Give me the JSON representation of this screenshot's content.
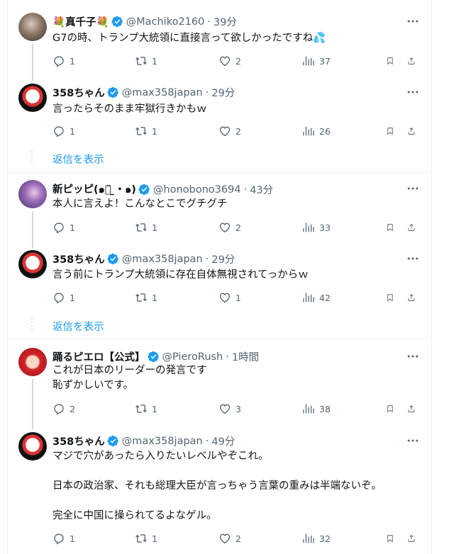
{
  "threads": [
    {
      "parent": {
        "name": "💐真千子💐",
        "handle": "@Machiko2160",
        "dot": "·",
        "time": "39分",
        "text": [
          "G7の時、トランプ大統領に直接言って欲しかったですね💦"
        ],
        "replies": "1",
        "retweets": "1",
        "likes": "2",
        "views": "37"
      },
      "reply": {
        "name": "358ちゃん",
        "handle": "@max358japan",
        "dot": "·",
        "time": "29分",
        "text": [
          "言ったらそのまま牢獄行きかもｗ"
        ],
        "replies": "1",
        "retweets": "1",
        "likes": "2",
        "views": "26"
      },
      "show_replies": "返信を表示"
    },
    {
      "parent": {
        "name": "新ピッピ(๑・̆ ̫・๑)",
        "handle": "@honobono3694",
        "dot": "·",
        "time": "43分",
        "text": [
          "本人に言えよ！こんなとこでグチグチ"
        ],
        "replies": "1",
        "retweets": "1",
        "likes": "2",
        "views": "33"
      },
      "reply": {
        "name": "358ちゃん",
        "handle": "@max358japan",
        "dot": "·",
        "time": "29分",
        "text": [
          "言う前にトランプ大統領に存在自体無視されてっからｗ"
        ],
        "replies": "1",
        "retweets": "1",
        "likes": "1",
        "views": "42"
      },
      "show_replies": "返信を表示"
    },
    {
      "parent": {
        "name": "踊るピエロ【公式】",
        "handle": "@PieroRush",
        "dot": "·",
        "time": "1時間",
        "text": [
          "これが日本のリーダーの発言です",
          "恥ずかしいです。"
        ],
        "replies": "2",
        "retweets": "1",
        "likes": "3",
        "views": "38"
      },
      "reply": {
        "name": "358ちゃん",
        "handle": "@max358japan",
        "dot": "·",
        "time": "49分",
        "text": [
          "マジで穴があったら入りたいレベルやぞこれ。",
          "",
          "日本の政治家、それも総理大臣が言っちゃう言葉の重みは半端ないぞ。",
          "",
          "完全に中国に操られてるよなゲル。"
        ],
        "replies": "1",
        "retweets": "1",
        "likes": "2",
        "views": "32"
      }
    }
  ],
  "icons": {
    "verified": "verified-badge-icon",
    "reply": "reply-icon",
    "retweet": "retweet-icon",
    "like": "heart-icon",
    "views": "views-icon",
    "bookmark": "bookmark-icon",
    "share": "share-icon",
    "more": "more-icon"
  },
  "colors": {
    "accent": "#1d9bf0",
    "muted": "#536471",
    "text": "#0f1419",
    "border": "#eff3f4"
  }
}
